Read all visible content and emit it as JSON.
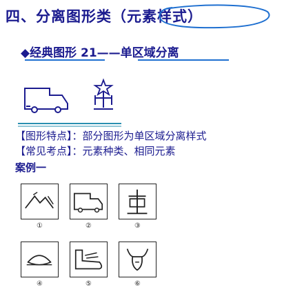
{
  "heading": {
    "prefix": "四、分离图形类",
    "circled": "（元素样式）"
  },
  "subheading": {
    "bullet": "◆",
    "text": "经典图形 21——单区域分离"
  },
  "points": [
    {
      "key": "【图形特点】",
      "value": "：部分图形为单区域分离样式"
    },
    {
      "key": "【常见考点】",
      "value": "：元素种类、相同元素"
    }
  ],
  "case_label": "案例一",
  "options_row1": [
    "①",
    "②",
    "③"
  ],
  "options_row2": [
    "④",
    "⑤",
    "⑥"
  ],
  "icons": {
    "example_left": "truck-outline-icon",
    "example_right": "figure-with-star-icon",
    "row1": [
      "mountain-figure-icon",
      "truck-figure-icon",
      "tower-figure-icon"
    ],
    "row2": [
      "ufo-figure-icon",
      "boot-figure-icon",
      "bull-head-figure-icon"
    ]
  },
  "colors": {
    "text": "#1b1b8f",
    "oval": "#1e6fd0",
    "underline": "#1e6fd0"
  }
}
